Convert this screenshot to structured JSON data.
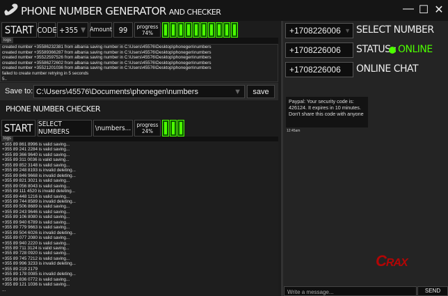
{
  "app": {
    "title": "PHONE NUMBER GENERATOR",
    "subtitle": "AND CHECKER",
    "minimize": "—",
    "maximize": "☐",
    "close": "✕"
  },
  "generator": {
    "start": "START",
    "code_label": "CODE",
    "code_value": "+355",
    "amount_label": "Amount",
    "amount_value": "99",
    "progress_label": "progress",
    "progress_value": "74%",
    "progress_fraction": 0.74,
    "logs_tab": "logs",
    "logs": [
      "created number +35586232381 from albania saving number in C:\\Users\\45576\\Desktop\\phonegen\\numbers",
      "created number +35589366287 from albania saving number in C:\\Users\\45576\\Desktop\\phonegen\\numbers",
      "created number +35522597526 from albania saving number in C:\\Users\\45576\\Desktop\\phonegen\\numbers",
      "created number +35586272602 from albania saving number in C:\\Users\\45576\\Desktop\\phonegen\\numbers",
      "created number +35521201036 from albania saving number in C:\\Users\\45576\\Desktop\\phonegen\\numbers",
      "failed to create number retrying in 5 seconds",
      "5.."
    ]
  },
  "save": {
    "label": "Save to:",
    "path": "C:\\Users\\45576\\Documents\\phonegen\\numbers",
    "button": "save"
  },
  "checker": {
    "heading": "PHONE NUMBER CHECKER",
    "start": "START",
    "select": "SELECT NUMBERS",
    "file": "\\numbers...",
    "progress_label": "progress",
    "progress_value": "24%",
    "progress_fraction": 0.24,
    "logs_tab": "logs",
    "logs": [
      "+355 89 861 8996 is valid saving...",
      "+355 89 241 2284 is valid saving...",
      "+355 89 366 9640 is valid saving...",
      "+355 89 311 0036 is valid saving...",
      "+355 89 852 3148 is valid saving...",
      "+355 89 248 8193 is invalid deleting...",
      "+355 89 846 9668 is invalid deleting...",
      "+355 89 821 3021 is valid saving...",
      "+355 89 056 8043 is valid saving...",
      "+355 89 111 4520 is invalid deleting...",
      "+355 89 448 1216 is valid saving...",
      "+355 89 744 8589 is invalid deleting...",
      "+355 89 506 8689 is valid saving...",
      "+355 89 243 9646 is valid saving...",
      "+355 89 106 8080 is valid saving...",
      "+355 89 940 6789 is valid saving...",
      "+355 89 779 9663 is valid saving...",
      "+355 89 504 6026 is invalid deleting...",
      "+355 89 077 2080 is valid saving...",
      "+355 89 940 2220 is valid saving...",
      "+355 89 711 3124 is valid saving...",
      "+355 89 728 0920 is valid saving...",
      "+355 89 745 7212 is valid saving...",
      "+355 89 996 3233 is invalid deleting...",
      "+355 89 219 2179",
      "+355 89 178 0085 is invalid deleting...",
      "+355 89 836 0772 is valid saving...",
      "+355 89 121 1036 is valid saving...",
      "..."
    ]
  },
  "right": {
    "number1": "+1708226006",
    "select_label": "SELECT NUMBER",
    "number2": "+1708226006",
    "status_label": "STATUS :",
    "status_value": "ONLINE",
    "number3": "+1708226006",
    "chat_label": "ONLINE CHAT",
    "message": "Paypal: Your security code is: 426124. It expires in 10 minutes. Don't share this code with anyone",
    "message_time": "12:45am",
    "input_placeholder": "Write a message...",
    "send": "SEND"
  },
  "watermark": "CRAX",
  "colors": {
    "green": "#4dff00"
  }
}
